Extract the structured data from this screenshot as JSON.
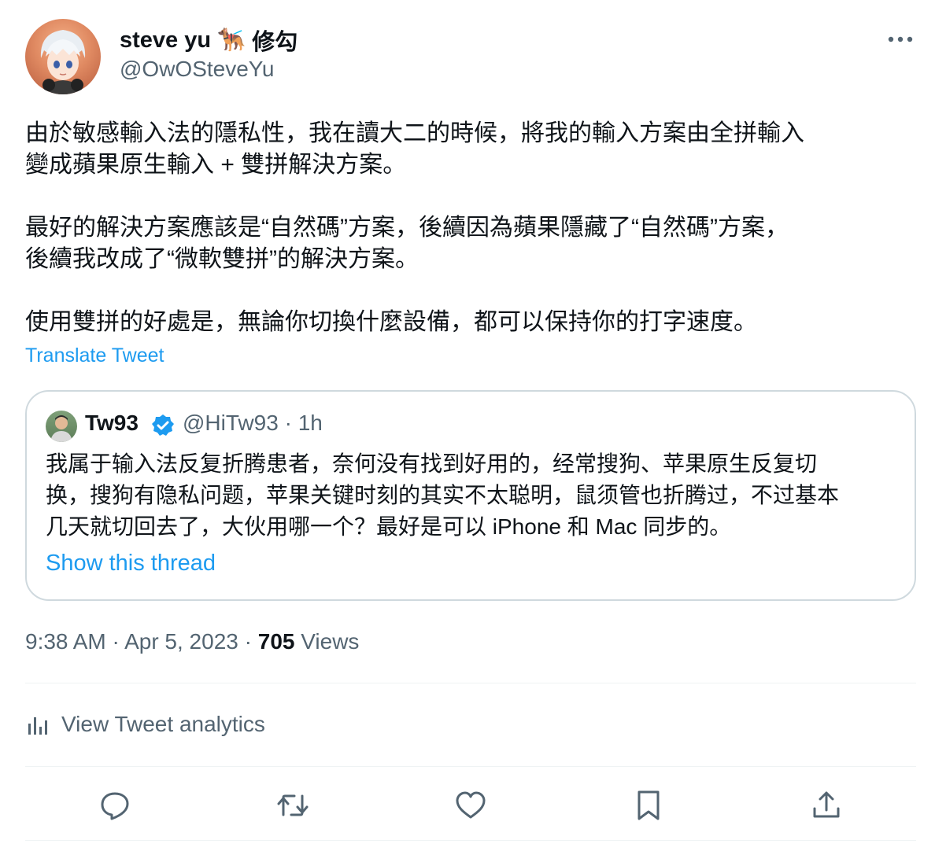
{
  "author": {
    "name": "steve yu",
    "emoji": "🐕‍🦺",
    "name_suffix": "修勾",
    "handle": "@OwOSteveYu"
  },
  "tweet": {
    "text": "由於敏感輸入法的隱私性，我在讀大二的時候，將我的輸入方案由全拼輸入\n變成蘋果原生輸入 + 雙拼解決方案。\n\n最好的解決方案應該是“自然碼”方案，後續因為蘋果隱藏了“自然碼”方案，\n後續我改成了“微軟雙拼”的解決方案。\n\n使用雙拼的好處是，無論你切換什麼設備，都可以保持你的打字速度。",
    "translate_label": "Translate Tweet"
  },
  "quote": {
    "name": "Tw93",
    "handle": "@HiTw93",
    "time": "1h",
    "separator": "·",
    "text": "我属于输入法反复折腾患者，奈何没有找到好用的，经常搜狗、苹果原生反复切\n换，搜狗有隐私问题，苹果关键时刻的其实不太聪明，鼠须管也折腾过，不过基本\n几天就切回去了，大伙用哪一个？最好是可以 iPhone 和 Mac 同步的。",
    "thread_label": "Show this thread"
  },
  "meta": {
    "time": "9:38 AM",
    "date": "Apr 5, 2023",
    "separator": "·",
    "views_count": "705",
    "views_label": "Views"
  },
  "analytics_label": "View Tweet analytics",
  "actions": [
    "reply-icon",
    "retweet-icon",
    "like-icon",
    "bookmark-icon",
    "share-icon"
  ],
  "colors": {
    "link": "#1d9bf0",
    "secondary_text": "#536471",
    "border": "#cfd9de",
    "divider": "#eff3f4",
    "verified": "#1d9bf0"
  }
}
